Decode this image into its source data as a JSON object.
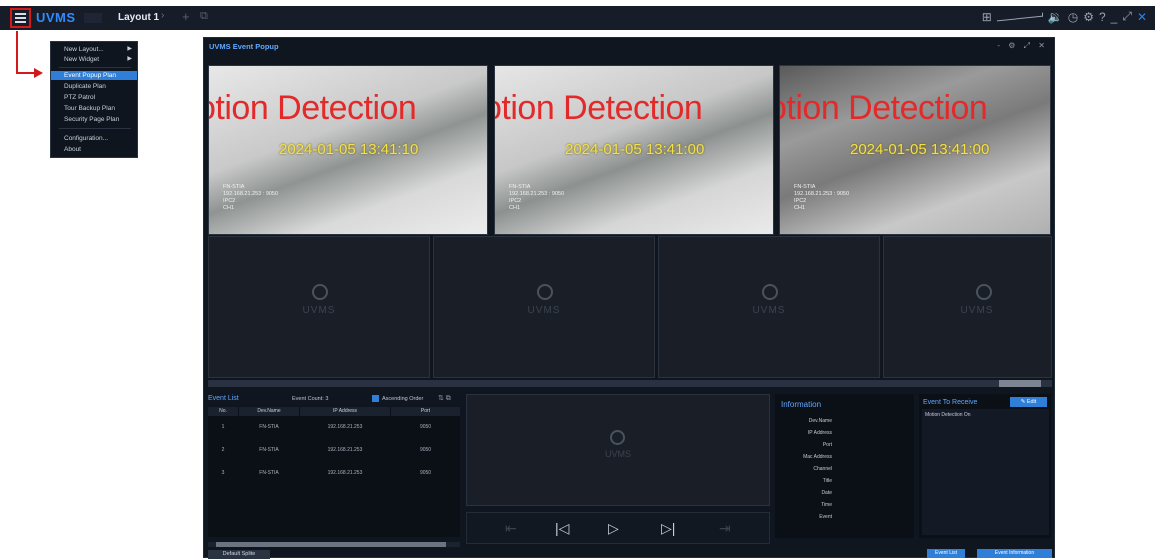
{
  "app": {
    "logo": "UVMS",
    "layout_tab": "Layout 1",
    "tab_chevron": "›",
    "add_tab": "+",
    "restore": "⧉"
  },
  "topbar_icons": {
    "grid": "⊞",
    "volume": "🔉",
    "clock": "◷",
    "gear": "⚙",
    "help": "?",
    "minimize": "_",
    "fullscreen": "⤢",
    "close": "✕"
  },
  "menu": {
    "items": [
      {
        "label": "New Layout...",
        "submenu": true,
        "selected": false
      },
      {
        "label": "New Widget",
        "submenu": true,
        "selected": false
      },
      {
        "label": "Event Popup Plan",
        "submenu": false,
        "selected": true
      },
      {
        "label": "Duplicate Plan",
        "submenu": false,
        "selected": false
      },
      {
        "label": "PTZ Patrol",
        "submenu": false,
        "selected": false
      },
      {
        "label": "Tour Backup Plan",
        "submenu": false,
        "selected": false
      },
      {
        "label": "Security Page Plan",
        "submenu": false,
        "selected": false
      },
      {
        "label": "Configuration...",
        "submenu": false,
        "selected": false
      },
      {
        "label": "About",
        "submenu": false,
        "selected": false
      }
    ]
  },
  "window": {
    "title": "UVMS Event Popup",
    "controls": "- ⚙ ⤢ ✕"
  },
  "snapshots": [
    {
      "detection_text": "otion Detection",
      "timestamp": "2024-01-05 13:41:10",
      "info": "FN-STIA\n192.168.21.253 : 9050\nIPC2\nCH1"
    },
    {
      "detection_text": "otion Detection",
      "timestamp": "2024-01-05 13:41:00",
      "info": "FN-STIA\n192.168.21.253 : 9050\nIPC2\nCH1"
    },
    {
      "detection_text": "otion Detection",
      "timestamp": "2024-01-05 13:41:00",
      "info": "FN-STIA\n192.168.21.253 : 9050\nIPC2\nCH1"
    }
  ],
  "empty_cell_watermark": "UVMS",
  "event_list": {
    "title": "Event List",
    "count_label": "Event Count:",
    "count": "3",
    "ascending_label": "Ascending Order",
    "icons": "⇅ ⧉",
    "columns": [
      "No.",
      "Dev.Name",
      "IP Address",
      "Port"
    ],
    "rows": [
      [
        "1",
        "FN-STIA",
        "192.168.21.253",
        "9050"
      ],
      [
        "2",
        "FN-STIA",
        "192.168.21.253",
        "9050"
      ],
      [
        "3",
        "FN-STIA",
        "192.168.21.253",
        "9050"
      ]
    ],
    "default_button": "Default Splite"
  },
  "player": {
    "watermark": "UVMS",
    "controls": {
      "rewind": "⇤",
      "prev": "|◁",
      "play": "▷",
      "next": "▷|",
      "forward": "⇥"
    }
  },
  "information": {
    "title": "Information",
    "fields": [
      "Dev.Name",
      "IP Address",
      "Port",
      "Mac Address",
      "Channel",
      "Title",
      "Date",
      "Time",
      "Event"
    ]
  },
  "event_to_receive": {
    "title": "Event To Receive",
    "edit_label": "Edit",
    "items": [
      "Motion Detection On"
    ]
  },
  "buttons": {
    "event_list": "Event List",
    "event_information": "Event Information"
  },
  "colors": {
    "accent": "#2f7fd8",
    "annotation": "#d21a1a",
    "detection": "#e32a2a",
    "timestamp": "#f3e04a"
  }
}
